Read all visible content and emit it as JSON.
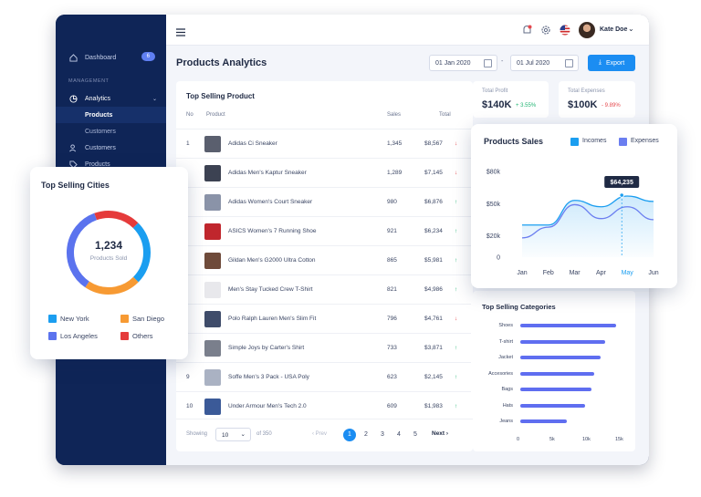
{
  "sidebar": {
    "items": [
      {
        "label": "Dashboard",
        "badge": "6",
        "icon": "home-icon"
      },
      {
        "label": "MANAGEMENT"
      },
      {
        "label": "Analytics",
        "icon": "pie-chart-icon"
      },
      {
        "label": "Products"
      },
      {
        "label": "Customers"
      },
      {
        "label": "Customers",
        "icon": "users-icon"
      },
      {
        "label": "Products",
        "icon": "tag-icon"
      }
    ]
  },
  "topbar": {
    "menu_icon": "hamburger-icon",
    "user_name": "Kate Doe",
    "icons": [
      "bell-icon",
      "gear-icon",
      "flag-icon"
    ]
  },
  "page": {
    "title": "Products Analytics",
    "date_from": "01 Jan 2020",
    "date_sep": "-",
    "date_to": "01 Jul 2020",
    "export_label": "Export"
  },
  "top_products": {
    "title": "Top Selling Product",
    "columns": [
      "No",
      "Product",
      "Sales",
      "Total"
    ],
    "rows": [
      {
        "no": "1",
        "name": "Adidas Ci Sneaker",
        "sales": "1,345",
        "total": "$8,567",
        "trend": "down"
      },
      {
        "no": "",
        "name": "Adidas Men's Kaptur Sneaker",
        "sales": "1,289",
        "total": "$7,145",
        "trend": "down"
      },
      {
        "no": "",
        "name": "Adidas Women's Court Sneaker",
        "sales": "980",
        "total": "$6,876",
        "trend": "up"
      },
      {
        "no": "",
        "name": "ASICS Women's 7 Running Shoe",
        "sales": "921",
        "total": "$6,234",
        "trend": "up"
      },
      {
        "no": "",
        "name": "Gildan Men's G2000 Ultra Cotton",
        "sales": "865",
        "total": "$5,981",
        "trend": "up"
      },
      {
        "no": "",
        "name": "Men's Stay Tucked Crew T-Shirt",
        "sales": "821",
        "total": "$4,986",
        "trend": "up"
      },
      {
        "no": "",
        "name": "Polo Ralph Lauren Men's Slim Fit",
        "sales": "796",
        "total": "$4,761",
        "trend": "down"
      },
      {
        "no": "",
        "name": "Simple Joys by Carter's Shirt",
        "sales": "733",
        "total": "$3,871",
        "trend": "up"
      },
      {
        "no": "9",
        "name": "Soffe Men's 3 Pack - USA Poly",
        "sales": "623",
        "total": "$2,145",
        "trend": "up"
      },
      {
        "no": "10",
        "name": "Under Armour Men's Tech 2.0",
        "sales": "609",
        "total": "$1,983",
        "trend": "up"
      }
    ],
    "showing_label": "Showing",
    "page_size": "10",
    "of_label": "of 350",
    "prev_label": "Prev",
    "next_label": "Next",
    "pages": [
      "1",
      "2",
      "3",
      "4",
      "5"
    ],
    "current_page": "1"
  },
  "kpis": [
    {
      "label": "Total Profit",
      "value": "$140K",
      "delta": "+ 3.55%"
    },
    {
      "label": "Total Expenses",
      "value": "$100K",
      "delta": "- 9.89%"
    }
  ],
  "cities_card": {
    "title": "Top Selling Cities",
    "center_value": "1,234",
    "center_label": "Products Sold",
    "legend": [
      "New York",
      "San Diego",
      "Los Angeles",
      "Others"
    ],
    "colors": [
      "#1b9ef0",
      "#f79a33",
      "#5b73ee",
      "#e53b3b"
    ]
  },
  "categories_card": {
    "title": "Top Selling Categories"
  },
  "colors": {
    "accent": "#1b8df2",
    "sidebar": "#0f2557",
    "incomes": "#1b9ef0",
    "expenses": "#6b7ef0"
  },
  "chart_data": [
    {
      "type": "pie",
      "title": "Top Selling Cities",
      "categories": [
        "New York",
        "San Diego",
        "Los Angeles",
        "Others"
      ],
      "values": [
        25,
        22,
        35,
        18
      ]
    },
    {
      "type": "line",
      "title": "Products Sales",
      "x": [
        "Jan",
        "Feb",
        "Mar",
        "Apr",
        "May",
        "Jun"
      ],
      "yticks": [
        "$80k",
        "$50k",
        "$20k",
        "0"
      ],
      "ylim": [
        0,
        80
      ],
      "series": [
        {
          "name": "Incomes",
          "values": [
            30,
            30,
            53,
            47,
            57,
            52
          ]
        },
        {
          "name": "Expenses",
          "values": [
            18,
            28,
            49,
            36,
            47,
            35
          ]
        }
      ],
      "annotation": "$64,235",
      "legend": "top-right"
    },
    {
      "type": "bar",
      "orientation": "horizontal",
      "title": "Top Selling Categories",
      "categories": [
        "Shoes",
        "T-shirt",
        "Jacket",
        "Accesories",
        "Bags",
        "Hats",
        "Jeans"
      ],
      "values": [
        15.5,
        13.8,
        13.0,
        12.0,
        11.5,
        10.5,
        7.5
      ],
      "xticks": [
        "0",
        "5k",
        "10k",
        "15k"
      ],
      "xlim": [
        0,
        16
      ]
    }
  ]
}
